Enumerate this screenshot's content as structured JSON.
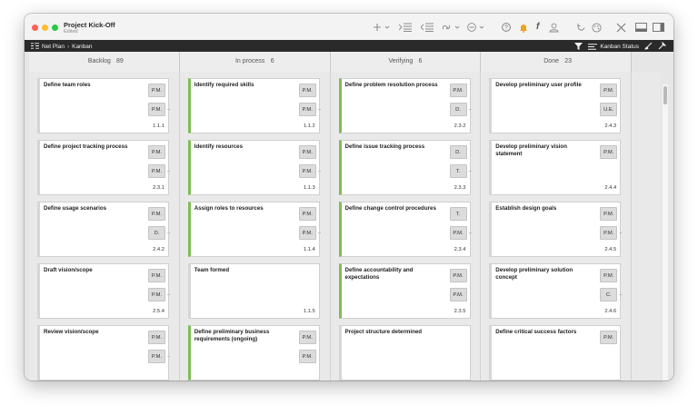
{
  "window": {
    "title": "Project Kick-Off",
    "subtitle": "Edited"
  },
  "toolbar": {
    "icons": [
      "plus-icon",
      "indent-icon",
      "outdent-icon",
      "link-icon",
      "more-circle-icon",
      "help-icon",
      "bell-icon",
      "font-icon",
      "person-icon",
      "refresh-icon",
      "palette-icon",
      "tools-icon",
      "window-icon",
      "sidebar-icon"
    ]
  },
  "pathbar": {
    "crumb1": "Net Plan",
    "crumb2": "Kanban",
    "status_label": "Kanban Status"
  },
  "columns": [
    {
      "name": "Backlog",
      "count": "89",
      "cards": [
        {
          "title": "Define team roles",
          "res1": "P.M.",
          "res2": "P.M.",
          "more2": "..",
          "num": "1.1.1",
          "green": false
        },
        {
          "title": "Define project tracking process",
          "res1": "P.M.",
          "res2": "P.M.",
          "more2": "..",
          "num": "2.3.1",
          "green": false
        },
        {
          "title": "Define usage scenarios",
          "res1": "P.M.",
          "res2": "D.",
          "more2": "..",
          "num": "2.4.2",
          "green": false
        },
        {
          "title": "Draft vision/scope",
          "res1": "P.M.",
          "res2": "P.M.",
          "more2": "..",
          "num": "2.5.4",
          "green": false
        },
        {
          "title": "Review vision/scope",
          "res1": "P.M.",
          "res2": "P.M.",
          "more2": "..",
          "num": "",
          "green": false
        }
      ]
    },
    {
      "name": "In process",
      "count": "6",
      "cards": [
        {
          "title": "Identify required skills",
          "res1": "P.M.",
          "res2": "P.M.",
          "more2": "..",
          "num": "1.1.2",
          "green": true
        },
        {
          "title": "Identify resources",
          "res1": "P.M.",
          "res2": "P.M.",
          "more2": "..",
          "num": "1.1.3",
          "green": true
        },
        {
          "title": "Assign roles to resources",
          "res1": "P.M.",
          "res2": "P.M.",
          "more2": "..",
          "num": "1.1.4",
          "green": true
        },
        {
          "title": "Team formed",
          "res1": "",
          "res2": "",
          "more2": "",
          "num": "1.1.5",
          "green": false
        },
        {
          "title": "Define preliminary business requirements (ongoing)",
          "res1": "P.M.",
          "res2": "P.M.",
          "more2": "",
          "num": "",
          "green": true
        }
      ]
    },
    {
      "name": "Verifying",
      "count": "6",
      "cards": [
        {
          "title": "Define problem resolution process",
          "res1": "P.M.",
          "res2": "D.",
          "more2": "..",
          "num": "2.3.2",
          "green": true
        },
        {
          "title": "Define issue tracking process",
          "res1": "D.",
          "res2": "T.",
          "more2": "..",
          "num": "2.3.3",
          "green": true
        },
        {
          "title": "Define change control procedures",
          "res1": "T.",
          "res2": "P.M.",
          "more2": "..",
          "num": "2.3.4",
          "green": true
        },
        {
          "title": "Define accountability and expectations",
          "res1": "P.M.",
          "res2": "P.M.",
          "more2": "",
          "num": "2.3.5",
          "green": true
        },
        {
          "title": "Project structure determined",
          "res1": "",
          "res2": "",
          "more2": "",
          "num": "",
          "green": false
        }
      ]
    },
    {
      "name": "Done",
      "count": "23",
      "cards": [
        {
          "title": "Develop preliminary user profile",
          "res1": "P.M.",
          "res2": "U.E.",
          "more2": "",
          "num": "2.4.3",
          "green": false
        },
        {
          "title": "Develop preliminary vision statement",
          "res1": "P.M.",
          "res2": "",
          "more2": "",
          "num": "2.4.4",
          "green": false
        },
        {
          "title": "Establish design goals",
          "res1": "P.M.",
          "res2": "P.M.",
          "more2": "..",
          "num": "2.4.5",
          "green": false
        },
        {
          "title": "Develop preliminary solution concept",
          "res1": "P.M.",
          "res2": "C.",
          "more2": "..",
          "num": "2.4.6",
          "green": false
        },
        {
          "title": "Define critical success factors",
          "res1": "P.M.",
          "res2": "",
          "more2": "",
          "num": "",
          "green": false
        }
      ]
    }
  ]
}
